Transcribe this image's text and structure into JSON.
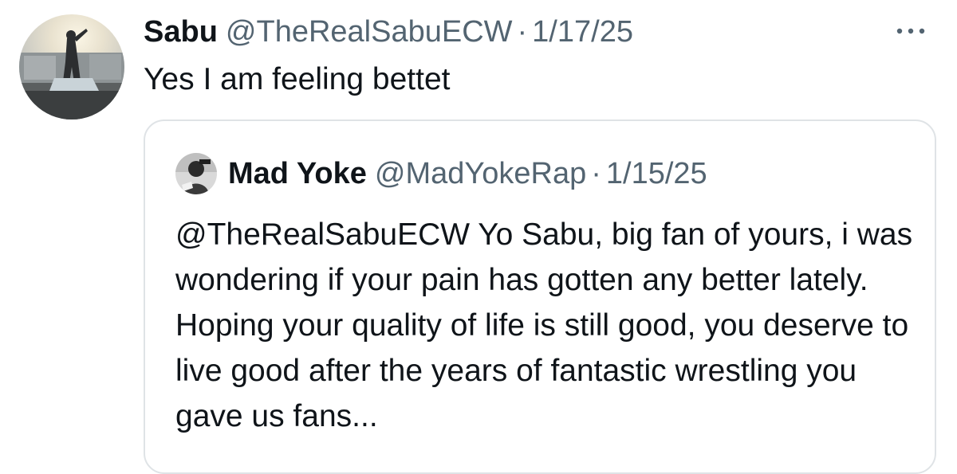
{
  "tweet": {
    "author_name": "Sabu",
    "author_handle": "@TheRealSabuECW",
    "separator": "·",
    "date": "1/17/25",
    "text": "Yes I am feeling bettet",
    "more_icon": "more-horizontal-icon"
  },
  "quoted_tweet": {
    "author_name": "Mad Yoke",
    "author_handle": "@MadYokeRap",
    "separator": "·",
    "date": "1/15/25",
    "text": "@TheRealSabuECW Yo Sabu, big fan of yours, i was wondering if your pain has gotten any better lately. Hoping your quality of life is still good, you deserve to live good after the years of fantastic wrestling you gave us fans..."
  },
  "colors": {
    "text_primary": "#0f1419",
    "text_secondary": "#536471",
    "border": "#dfe3e6"
  }
}
